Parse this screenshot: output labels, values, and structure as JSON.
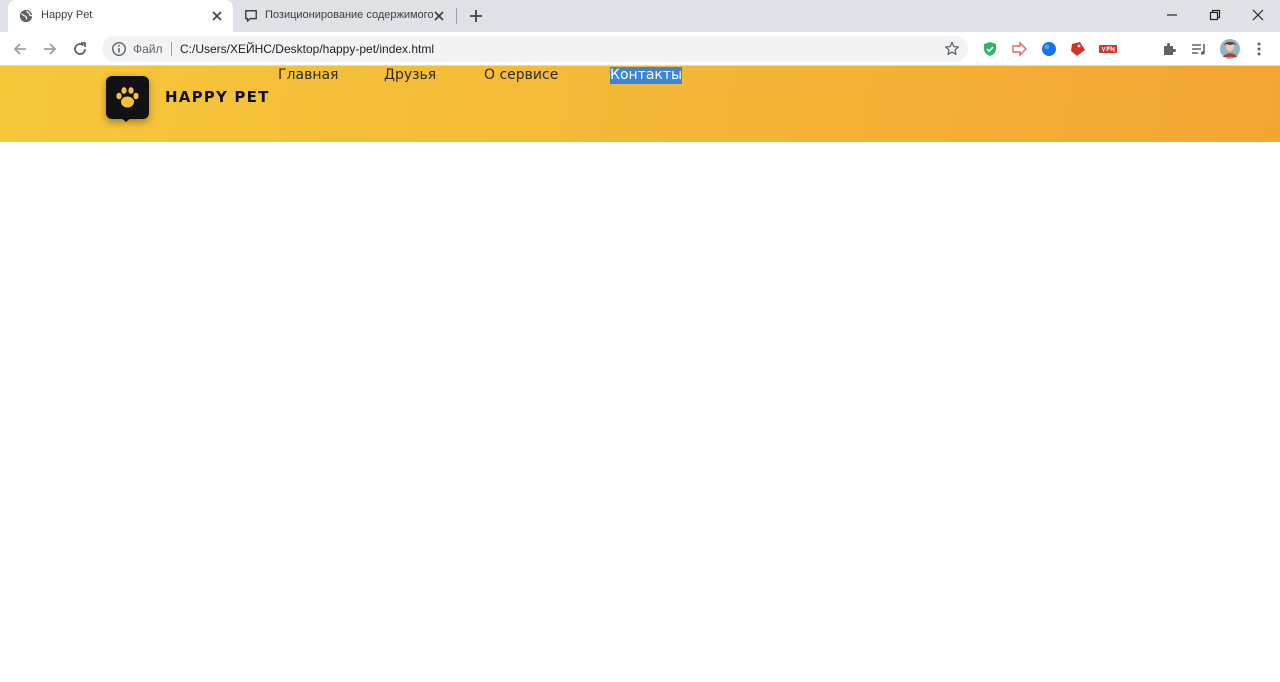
{
  "browser": {
    "tabs": [
      {
        "title": "Happy Pet",
        "active": true
      },
      {
        "title": "Позиционирование содержимого",
        "active": false
      }
    ],
    "address_bar": {
      "scheme_label": "Файл",
      "url": "C:/Users/ХЕЙНС/Desktop/happy-pet/index.html"
    },
    "extensions": [
      "shield-extension",
      "arrow-extension",
      "globe-extension",
      "red-tag-extension",
      "vpn-extension"
    ]
  },
  "site": {
    "brand": "HAPPY PET",
    "nav": [
      {
        "label": "Главная",
        "selected": false
      },
      {
        "label": "Друзья",
        "selected": false
      },
      {
        "label": "О сервисе",
        "selected": false
      },
      {
        "label": "Контакты",
        "selected": true
      }
    ],
    "colors": {
      "header_gradient_start": "#f5c83a",
      "header_gradient_end": "#f3a534",
      "logo_bg": "#111111",
      "logo_paw": "#f5c13a",
      "selection": "#3b84d6"
    }
  }
}
